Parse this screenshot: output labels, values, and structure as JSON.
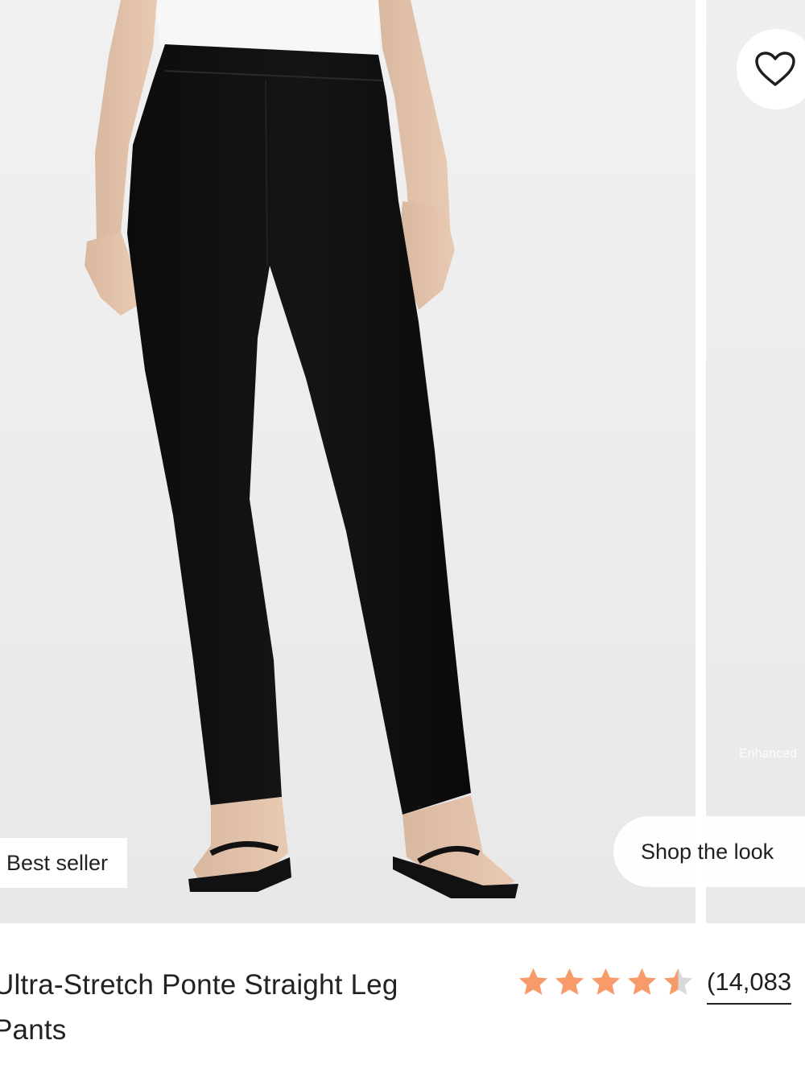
{
  "product": {
    "badge": "Best seller",
    "title_line1": "Ultra-Stretch Ponte Straight Leg",
    "title_line2": "Pants",
    "rating": 4.5,
    "rating_max": 5,
    "review_count": "(14,083"
  },
  "gallery": {
    "shop_the_look": "Shop the look",
    "next_slide_caption": "Enhanced"
  },
  "icons": {
    "wishlist": "heart-outline-icon",
    "star": "star-icon"
  },
  "colors": {
    "star": "#f79b6b",
    "star_empty": "#d9d9d9"
  }
}
